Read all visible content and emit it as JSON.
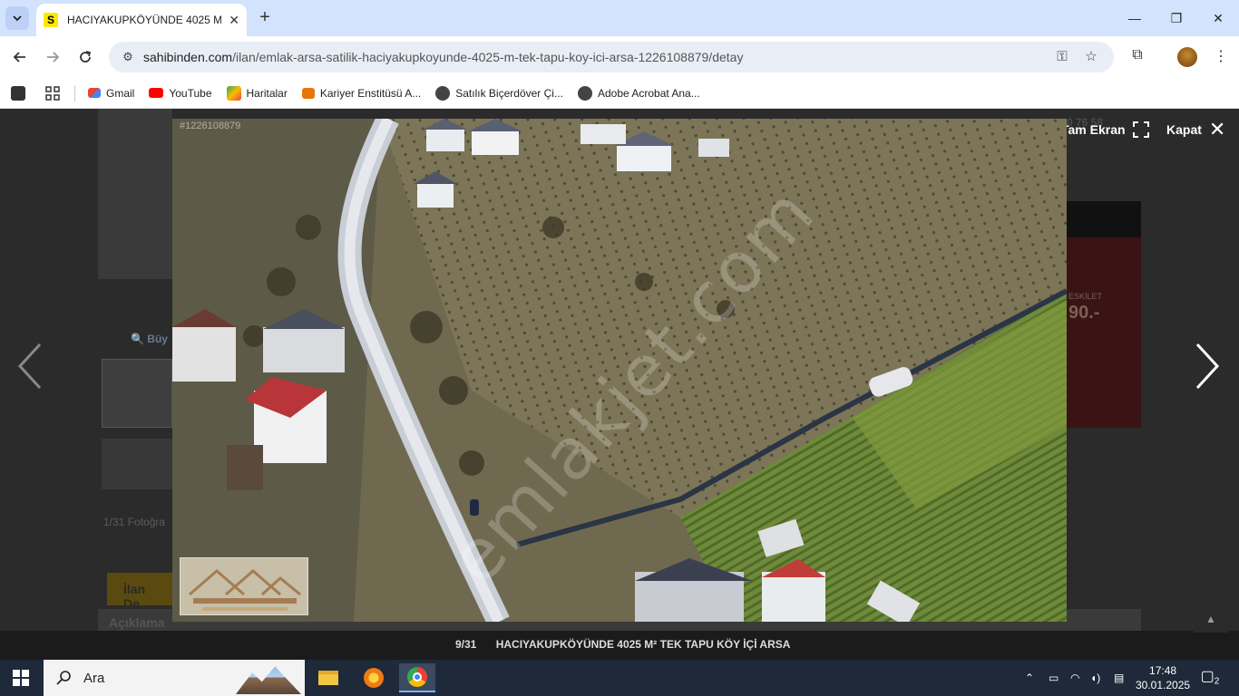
{
  "browser": {
    "tab_title": "HACIYAKUPKÖYÜNDE 4025 M²",
    "favicon_letter": "S",
    "url_domain": "sahibinden.com",
    "url_path": "/ilan/emlak-arsa-satilik-haciyakupkoyunde-4025-m-tek-tapu-koy-ici-arsa-1226108879/detay",
    "bookmarks": [
      "Gmail",
      "YouTube",
      "Haritalar",
      "Kariyer Enstitüsü A...",
      "Satılık Biçerdöver Çi...",
      "Adobe Acrobat Ana..."
    ]
  },
  "page_background": {
    "buyut_label": "Büy",
    "photo_count": "1/31 Fotoğra",
    "tab_label": "İlan De",
    "aciklama": "Açıklama",
    "right_top": "0 76 58",
    "ad_small": "ESKİLET",
    "ad_big": "90.-"
  },
  "lightbox": {
    "fullscreen_label": "Tam Ekran",
    "close_label": "Kapat",
    "photo_id": "#1226108879",
    "watermark": "emlakjet.com",
    "counter": "9/31",
    "caption": "HACIYAKUPKÖYÜNDE 4025 M² TEK TAPU KÖY İÇİ ARSA"
  },
  "taskbar": {
    "search_placeholder": "Ara",
    "time": "17:48",
    "date": "30.01.2025",
    "notification_count": "2"
  },
  "colors": {
    "tab_strip": "#d3e3fd",
    "sahibinden_yellow": "#ffe800",
    "overlay_bg": "#202124",
    "taskbar": "#1e2a3a"
  }
}
